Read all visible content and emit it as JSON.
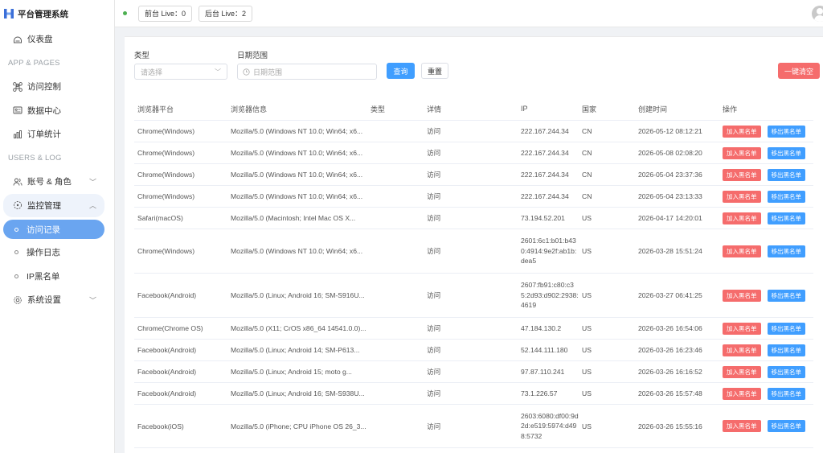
{
  "app": {
    "title": "平台管理系统"
  },
  "sidebar": {
    "dashboard": "仪表盘",
    "section1": "APP & PAGES",
    "access_control": "访问控制",
    "data_center": "数据中心",
    "order_stats": "订单统计",
    "section2": "USERS & LOG",
    "accounts_roles": "账号 & 角色",
    "monitoring": "监控管理",
    "access_log": "访问记录",
    "operation_log": "操作日志",
    "ip_blacklist": "IP黑名单",
    "settings": "系统设置"
  },
  "header": {
    "front_live": "前台 Live：0",
    "back_live": "后台 Live：2"
  },
  "filters": {
    "type_label": "类型",
    "type_placeholder": "请选择",
    "date_label": "日期范围",
    "date_placeholder": "日期范围",
    "query_button": "查询",
    "reset_button": "重置",
    "clear_all_button": "一键清空"
  },
  "table": {
    "headers": [
      "浏览器平台",
      "浏览器信息",
      "类型",
      "详情",
      "IP",
      "国家",
      "创建时间",
      "操作"
    ],
    "action_block": "加入黑名单",
    "action_unblock": "移出黑名单",
    "rows": [
      {
        "platform": "Chrome(Windows)",
        "ua": "Mozilla/5.0 (Windows NT 10.0; Win64; x6...",
        "type": "",
        "detail": "访问",
        "ip": "222.167.244.34",
        "country": "CN",
        "time": "2026-05-12 08:12:21"
      },
      {
        "platform": "Chrome(Windows)",
        "ua": "Mozilla/5.0 (Windows NT 10.0; Win64; x6...",
        "type": "",
        "detail": "访问",
        "ip": "222.167.244.34",
        "country": "CN",
        "time": "2026-05-08 02:08:20"
      },
      {
        "platform": "Chrome(Windows)",
        "ua": "Mozilla/5.0 (Windows NT 10.0; Win64; x6...",
        "type": "",
        "detail": "访问",
        "ip": "222.167.244.34",
        "country": "CN",
        "time": "2026-05-04 23:37:36"
      },
      {
        "platform": "Chrome(Windows)",
        "ua": "Mozilla/5.0 (Windows NT 10.0; Win64; x6...",
        "type": "",
        "detail": "访问",
        "ip": "222.167.244.34",
        "country": "CN",
        "time": "2026-05-04 23:13:33"
      },
      {
        "platform": "Safari(macOS)",
        "ua": "Mozilla/5.0 (Macintosh; Intel Mac OS X...",
        "type": "",
        "detail": "访问",
        "ip": "73.194.52.201",
        "country": "US",
        "time": "2026-04-17 14:20:01"
      },
      {
        "platform": "Chrome(Windows)",
        "ua": "Mozilla/5.0 (Windows NT 10.0; Win64; x6...",
        "type": "",
        "detail": "访问",
        "ip": "2601:6c1:b01:b430:4914:9e2f:ab1b:dea5",
        "country": "US",
        "time": "2026-03-28 15:51:24"
      },
      {
        "platform": "Facebook(Android)",
        "ua": "Mozilla/5.0 (Linux; Android 16; SM-S916U...",
        "type": "",
        "detail": "访问",
        "ip": "2607:fb91:c80:c35:2d93:d902:2938:4619",
        "country": "US",
        "time": "2026-03-27 06:41:25"
      },
      {
        "platform": "Chrome(Chrome OS)",
        "ua": "Mozilla/5.0 (X11; CrOS x86_64 14541.0.0)...",
        "type": "",
        "detail": "访问",
        "ip": "47.184.130.2",
        "country": "US",
        "time": "2026-03-26 16:54:06"
      },
      {
        "platform": "Facebook(Android)",
        "ua": "Mozilla/5.0 (Linux; Android 14; SM-P613...",
        "type": "",
        "detail": "访问",
        "ip": "52.144.111.180",
        "country": "US",
        "time": "2026-03-26 16:23:46"
      },
      {
        "platform": "Facebook(Android)",
        "ua": "Mozilla/5.0 (Linux; Android 15; moto g...",
        "type": "",
        "detail": "访问",
        "ip": "97.87.110.241",
        "country": "US",
        "time": "2026-03-26 16:16:52"
      },
      {
        "platform": "Facebook(Android)",
        "ua": "Mozilla/5.0 (Linux; Android 16; SM-S938U...",
        "type": "",
        "detail": "访问",
        "ip": "73.1.226.57",
        "country": "US",
        "time": "2026-03-26 15:57:48"
      },
      {
        "platform": "Facebook(iOS)",
        "ua": "Mozilla/5.0 (iPhone; CPU iPhone OS 26_3...",
        "type": "",
        "detail": "访问",
        "ip": "2603:6080:df00:9d2d:e519:5974:d498:5732",
        "country": "US",
        "time": "2026-03-26 15:55:16"
      }
    ]
  }
}
